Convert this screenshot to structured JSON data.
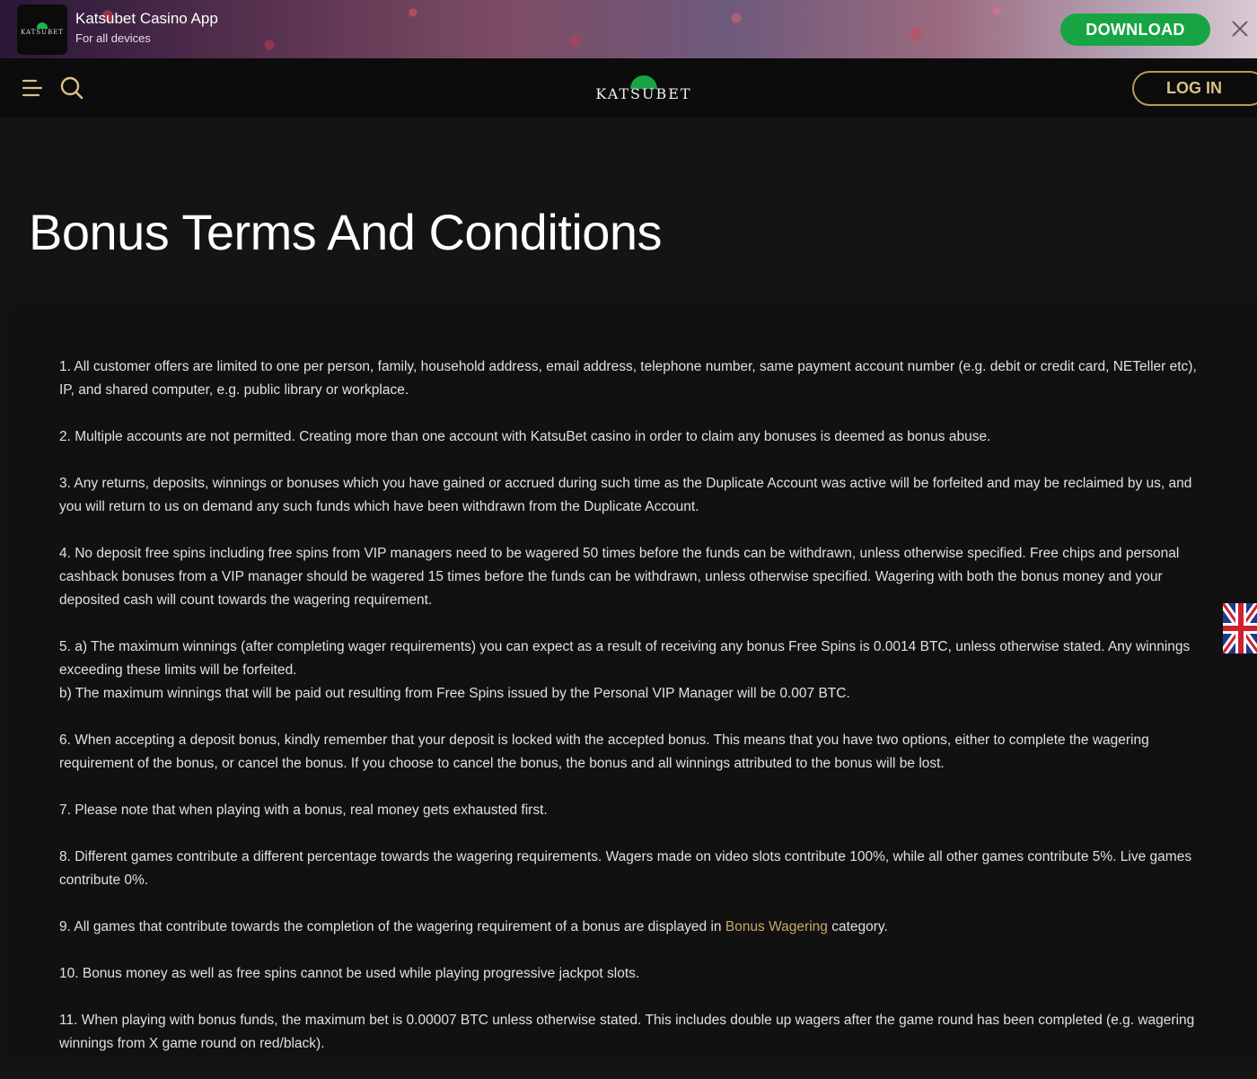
{
  "banner": {
    "logo_text": "KATSUBET",
    "title": "Katsubet Casino App",
    "subtitle": "For all devices",
    "download_label": "DOWNLOAD"
  },
  "nav": {
    "brand": "KATSUBET",
    "login_label": "LOG IN"
  },
  "page": {
    "title": "Bonus Terms And Conditions"
  },
  "terms": {
    "t1": "1. All customer offers are limited to one per person, family, household address, email address, telephone number, same payment account number (e.g. debit or credit card, NETeller etc), IP, and shared computer, e.g. public library or workplace.",
    "t2": "2. Multiple accounts are not permitted. Creating more than one account with KatsuBet casino in order to claim any bonuses is deemed as bonus abuse.",
    "t3": "3. Any returns, deposits, winnings or bonuses which you have gained or accrued during such time as the Duplicate Account was active will be forfeited and may be reclaimed by us, and you will return to us on demand any such funds which have been withdrawn from the Duplicate Account.",
    "t4": "4. No deposit free spins including free spins from VIP managers need to be wagered 50 times before the funds can be withdrawn, unless otherwise specified. Free chips and personal cashback bonuses from a VIP manager should be wagered 15 times before the funds can be withdrawn, unless otherwise specified. Wagering with both the bonus money and your deposited cash will count towards the wagering requirement.",
    "t5a": "5. a) The maximum winnings (after completing wager requirements) you can expect as a result of receiving any bonus Free Spins is 0.0014 BTC, unless otherwise stated. Any winnings exceeding these limits will be forfeited.",
    "t5b": "b) The maximum winnings that will be paid out resulting from Free Spins issued by the Personal VIP Manager will be 0.007 BTC.",
    "t6": "6. When accepting a deposit bonus, kindly remember that your deposit is locked with the accepted bonus. This means that you have two options, either to complete the wagering requirement of the bonus, or cancel the bonus. If you choose to cancel the bonus, the bonus and all winnings attributed to the bonus will be lost.",
    "t7": "7. Please note that when playing with a bonus, real money gets exhausted first.",
    "t8": "8. Different games contribute a different percentage towards the wagering requirements. Wagers made on video slots contribute 100%, while all other games contribute 5%. Live games contribute 0%.",
    "t9_pre": "9. All games that contribute towards the completion of the wagering requirement of a bonus are displayed in ",
    "t9_link": "Bonus Wagering",
    "t9_post": " category.",
    "t10": "10. Bonus money as well as free spins cannot be used while playing progressive jackpot slots.",
    "t11": "11. When playing with bonus funds, the maximum bet is 0.00007 BTC unless otherwise stated. This includes double up wagers after the game round has been completed (e.g. wagering winnings from X game round on red/black)."
  },
  "colors": {
    "download_green": "#17a544",
    "login_gold": "#b99a55",
    "link_gold": "#c9a86a",
    "background": "#141414"
  },
  "icons": {
    "menu": "hamburger-menu-icon",
    "search": "search-icon",
    "close": "close-icon",
    "language": "uk-flag-icon"
  }
}
